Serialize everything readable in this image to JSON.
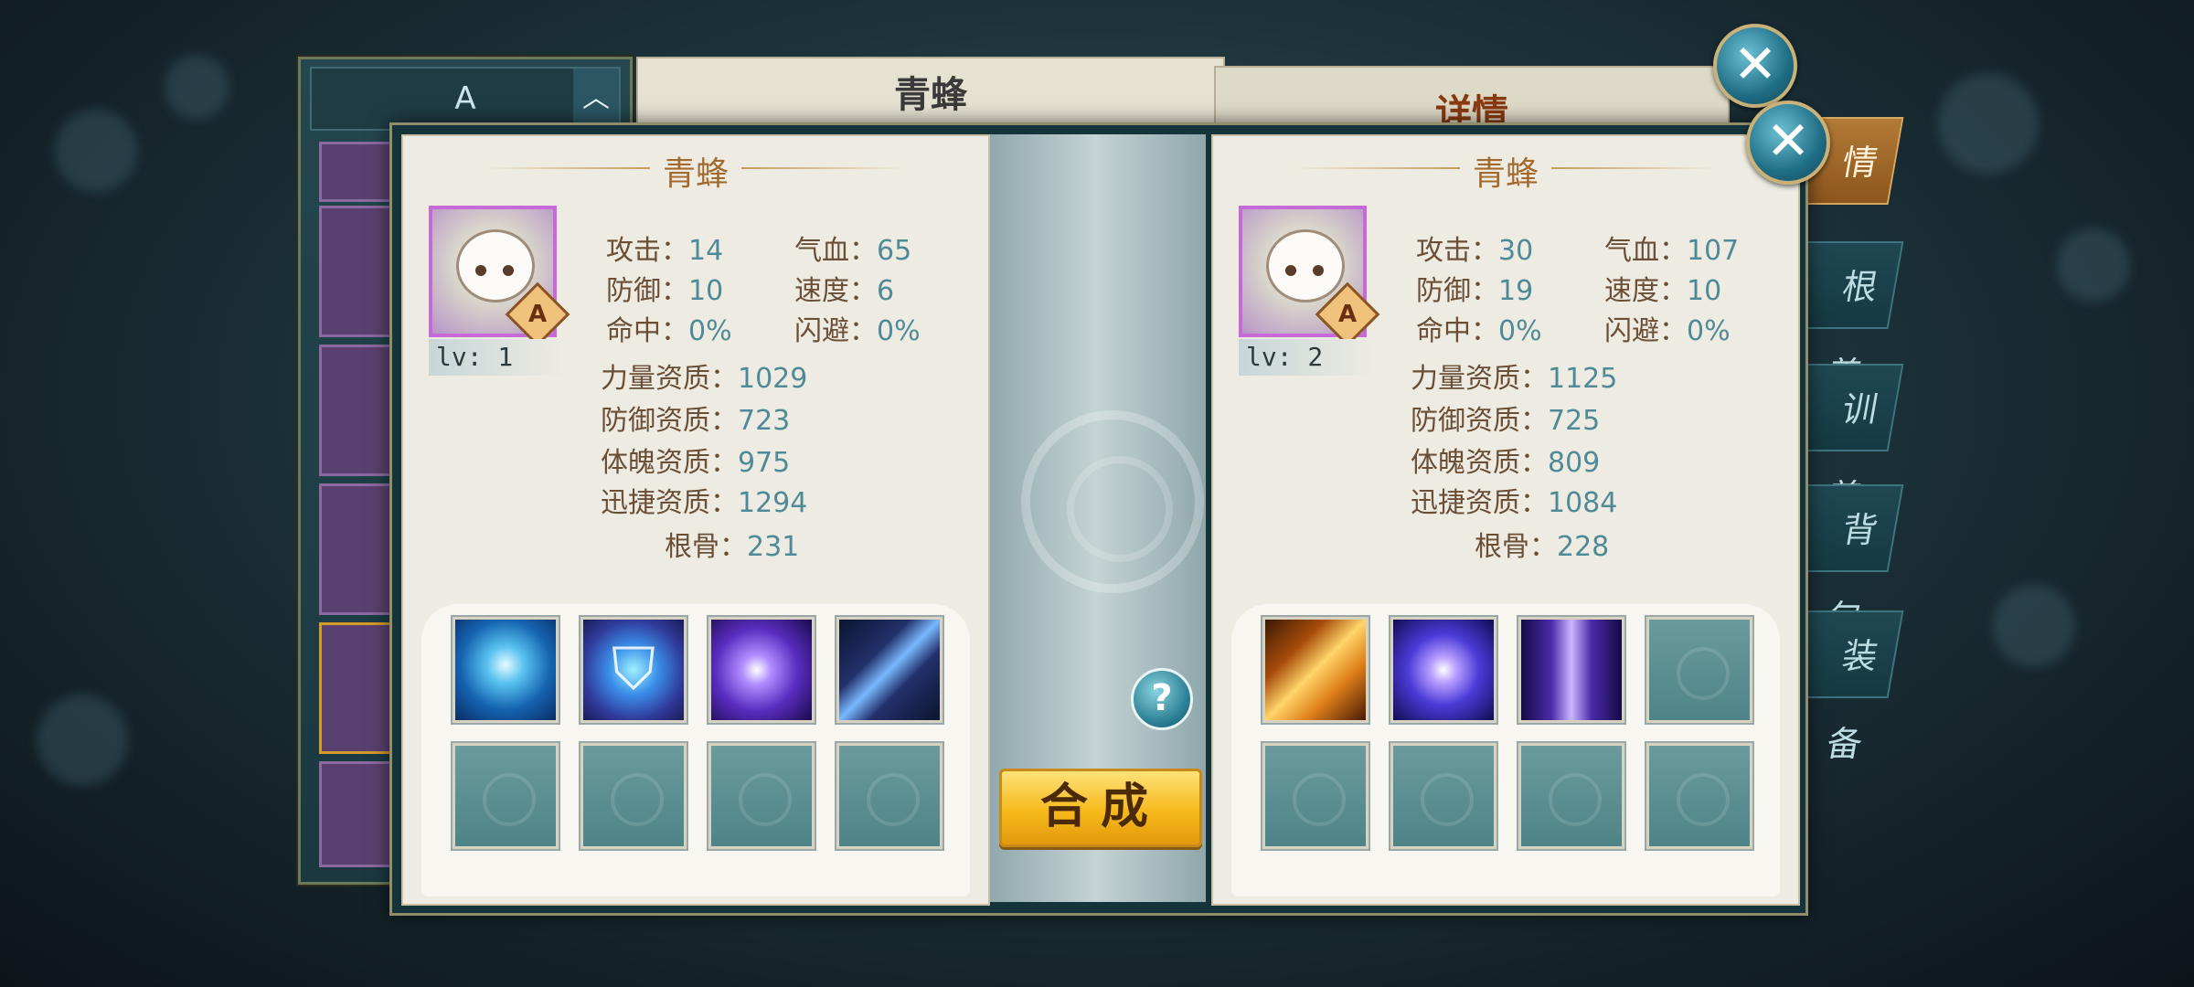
{
  "background": {
    "list_header": "A",
    "list_arrow": "︿",
    "mid_title": "青蜂",
    "right_title": "详情",
    "tabs": [
      {
        "label": "情",
        "active": true
      },
      {
        "label": "根 养",
        "active": false
      },
      {
        "label": "训 养",
        "active": false
      },
      {
        "label": "背 包",
        "active": false
      },
      {
        "label": "装 备",
        "active": false
      }
    ]
  },
  "dialog": {
    "help_label": "?",
    "merge_label": "合成",
    "close_icon": "close-icon",
    "left_pet": {
      "name": "青蜂",
      "grade": "A",
      "level": "lv: 1",
      "stats": {
        "attack_label": "攻击：",
        "attack": "14",
        "hp_label": "气血：",
        "hp": "65",
        "defense_label": "防御：",
        "defense": "10",
        "speed_label": "速度：",
        "speed": "6",
        "hit_label": "命中：",
        "hit": "0%",
        "dodge_label": "闪避：",
        "dodge": "0%"
      },
      "aptitudes": {
        "str_label": "力量资质：",
        "str": "1029",
        "def_label": "防御资质：",
        "def": "723",
        "con_label": "体魄资质：",
        "con": "975",
        "agi_label": "迅捷资质：",
        "agi": "1294",
        "root_label": "根骨：",
        "root": "231"
      },
      "skills": [
        "lightning-skill-icon",
        "shield-skill-icon",
        "vortex-skill-icon",
        "claw-skill-icon",
        "",
        "",
        "",
        ""
      ]
    },
    "right_pet": {
      "name": "青蜂",
      "grade": "A",
      "level": "lv: 2",
      "stats": {
        "attack_label": "攻击：",
        "attack": "30",
        "hp_label": "气血：",
        "hp": "107",
        "defense_label": "防御：",
        "defense": "19",
        "speed_label": "速度：",
        "speed": "10",
        "hit_label": "命中：",
        "hit": "0%",
        "dodge_label": "闪避：",
        "dodge": "0%"
      },
      "aptitudes": {
        "str_label": "力量资质：",
        "str": "1125",
        "def_label": "防御资质：",
        "def": "725",
        "con_label": "体魄资质：",
        "con": "809",
        "agi_label": "迅捷资质：",
        "agi": "1084",
        "root_label": "根骨：",
        "root": "228"
      },
      "skills": [
        "fire-skill-icon",
        "orb-skill-icon",
        "pillar-skill-icon",
        "",
        "",
        "",
        "",
        ""
      ]
    }
  },
  "colors": {
    "accent_gold": "#f6b91b",
    "grade_border": "#c66ad8",
    "value_teal": "#4f8a98",
    "label_brown": "#6a4e36"
  }
}
